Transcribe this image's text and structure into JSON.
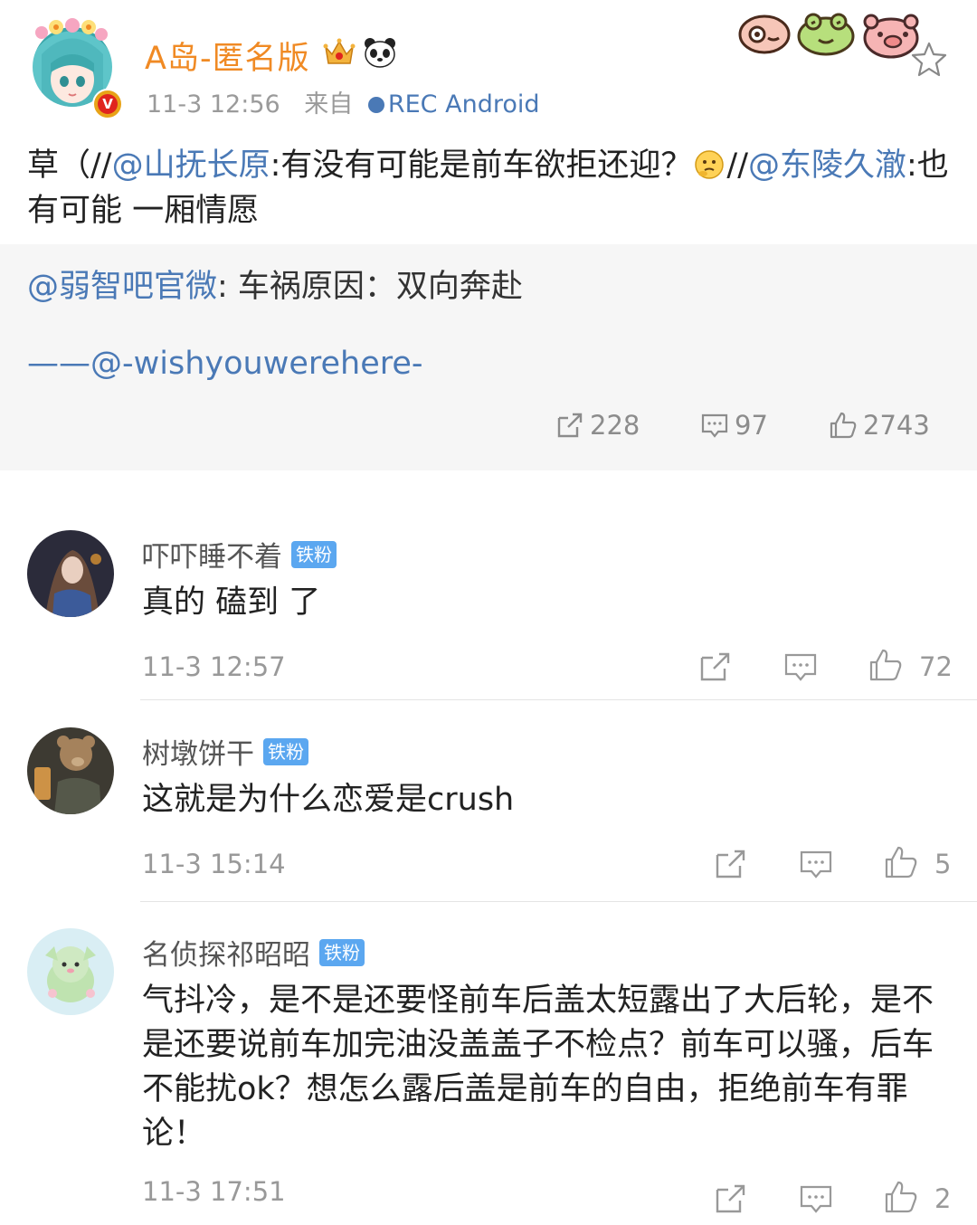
{
  "post": {
    "author": "A岛-匿名版",
    "verified_badge": "V",
    "time": "11-3 12:56",
    "source_prefix": "来自",
    "source": "REC  Android",
    "text_1": "草（//",
    "mention_1": "@山抚长原",
    "text_2": ":有没有可能是前车欲拒还迎？",
    "text_3": "//",
    "mention_2": "@东陵久澈",
    "text_4": ":也有可能  一厢情愿",
    "icons": [
      "crown-icon",
      "panda-icon",
      "sticker-icons",
      "star-icon",
      "think-emoji"
    ]
  },
  "repost": {
    "mention": "@弱智吧官微",
    "text": ": 车祸原因：双向奔赴",
    "credit": "——@-wishyouwerehere-",
    "reposts": "228",
    "comments": "97",
    "likes": "2743"
  },
  "comments": [
    {
      "name": "吓吓睡不着",
      "badge": "铁粉",
      "text": "真的 磕到 了",
      "time": "11-3 12:57",
      "likes": "72"
    },
    {
      "name": "树墩饼干",
      "badge": "铁粉",
      "text": "这就是为什么恋爱是crush",
      "time": "11-3 15:14",
      "likes": "5"
    },
    {
      "name": "名侦探祁昭昭",
      "badge": "铁粉",
      "text": "气抖冷，是不是还要怪前车后盖太短露出了大后轮，是不是还要说前车加完油没盖盖子不检点？前车可以骚，后车不能扰ok？想怎么露后盖是前车的自由，拒绝前车有罪论！",
      "time": "11-3 17:51",
      "likes": "2"
    }
  ],
  "colors": {
    "link": "#4a79b6",
    "author": "#f08a24",
    "badge": "#5ba7f0",
    "repost_bg": "#f6f6f6"
  }
}
